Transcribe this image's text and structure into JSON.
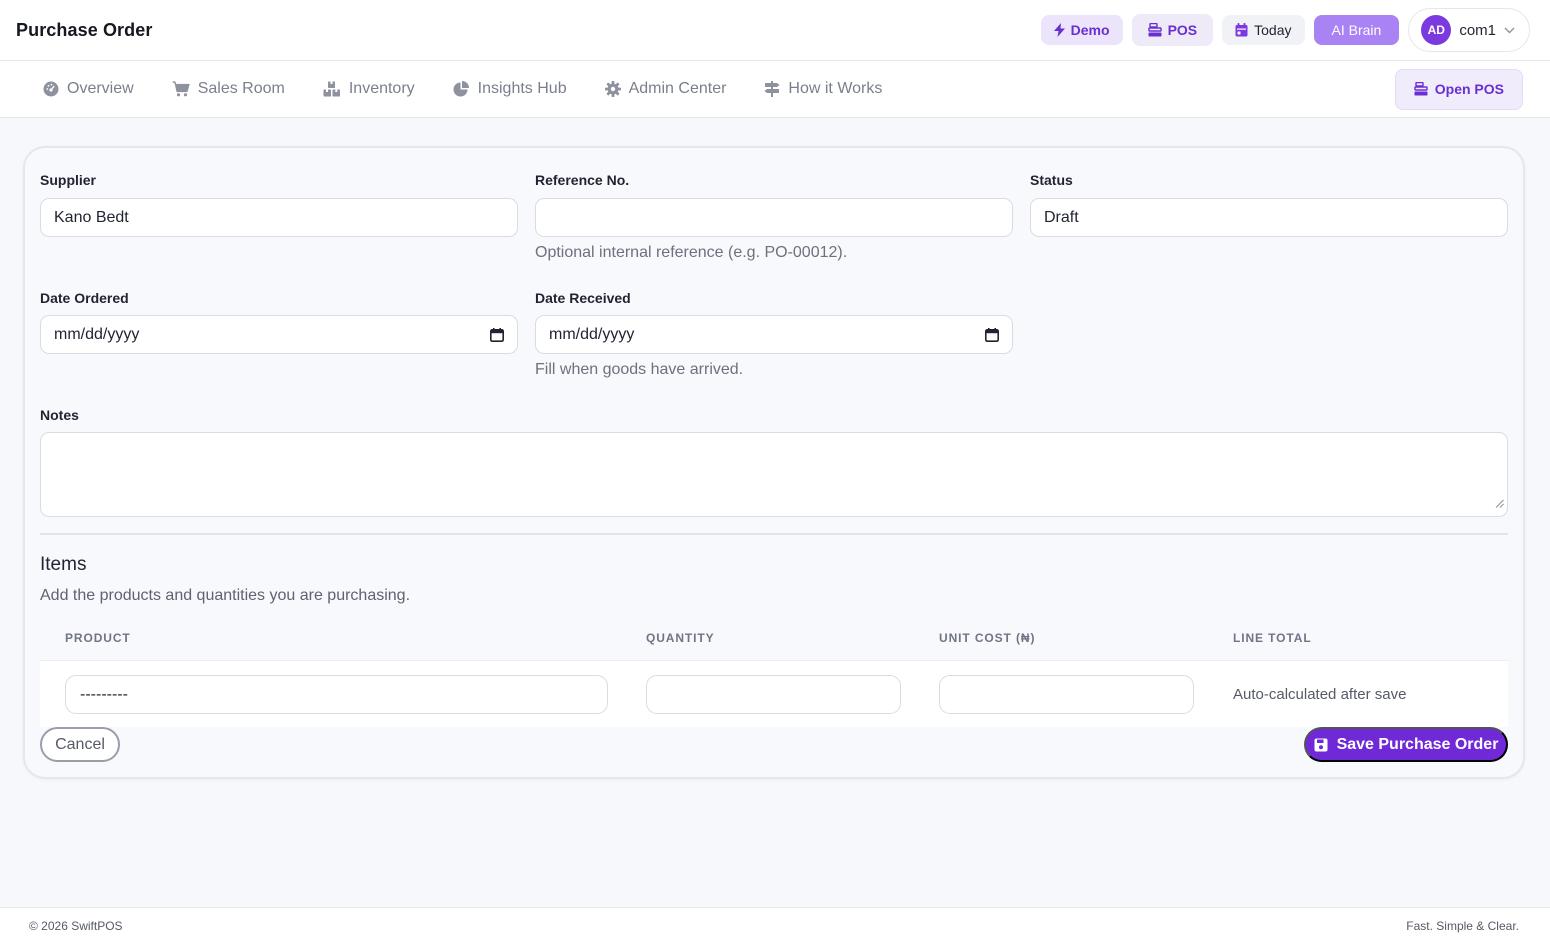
{
  "header": {
    "title": "Purchase Order",
    "demo_label": "Demo",
    "pos_label": "POS",
    "today_label": "Today",
    "ai_label": "AI Brain",
    "user": {
      "initials": "AD",
      "name": "com1"
    }
  },
  "nav": {
    "items": [
      {
        "label": "Overview",
        "icon": "dashboard-icon"
      },
      {
        "label": "Sales Room",
        "icon": "cart-icon"
      },
      {
        "label": "Inventory",
        "icon": "boxes-icon"
      },
      {
        "label": "Insights Hub",
        "icon": "pie-chart-icon"
      },
      {
        "label": "Admin Center",
        "icon": "gear-icon"
      },
      {
        "label": "How it Works",
        "icon": "signpost-icon"
      }
    ],
    "open_pos_label": "Open POS"
  },
  "form": {
    "supplier": {
      "label": "Supplier",
      "value": "Kano Bedt"
    },
    "reference": {
      "label": "Reference No.",
      "value": "",
      "help": "Optional internal reference (e.g. PO-00012)."
    },
    "status": {
      "label": "Status",
      "value": "Draft"
    },
    "date_ordered": {
      "label": "Date Ordered",
      "placeholder": "mm/dd/yyyy"
    },
    "date_received": {
      "label": "Date Received",
      "placeholder": "mm/dd/yyyy",
      "help": "Fill when goods have arrived."
    },
    "notes": {
      "label": "Notes",
      "value": ""
    }
  },
  "items": {
    "title": "Items",
    "subtitle": "Add the products and quantities you are purchasing.",
    "columns": [
      "PRODUCT",
      "QUANTITY",
      "UNIT COST (₦)",
      "LINE TOTAL"
    ],
    "rows": [
      {
        "product": "---------",
        "quantity": "",
        "unit_cost": "",
        "line_total": "Auto-calculated after save"
      }
    ]
  },
  "actions": {
    "cancel_label": "Cancel",
    "save_label": "Save Purchase Order"
  },
  "footer": {
    "copyright": "© 2026 SwiftPOS",
    "tagline": "Fast. Simple & Clear."
  },
  "colors": {
    "accent": "#7029d6",
    "accent_light": "#a982f3",
    "accent_soft": "#ebe4fb"
  }
}
